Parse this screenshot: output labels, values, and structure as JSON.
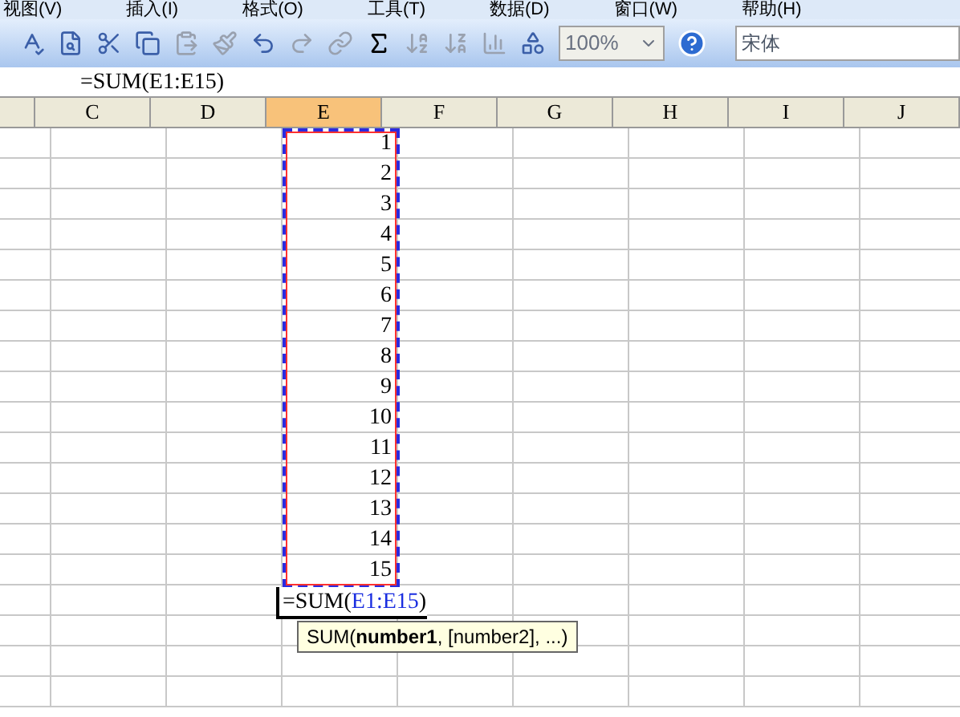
{
  "menu": [
    "视图(V)",
    "插入(I)",
    "格式(O)",
    "工具(T)",
    "数据(D)",
    "窗口(W)",
    "帮助(H)"
  ],
  "toolbar": {
    "zoom": "100%",
    "font": "宋体"
  },
  "formula_bar": {
    "value": "=SUM(E1:E15)"
  },
  "columns": [
    {
      "label": "C",
      "selected": false
    },
    {
      "label": "D",
      "selected": false
    },
    {
      "label": "E",
      "selected": true
    },
    {
      "label": "F",
      "selected": false
    },
    {
      "label": "G",
      "selected": false
    },
    {
      "label": "H",
      "selected": false
    },
    {
      "label": "I",
      "selected": false
    },
    {
      "label": "J",
      "selected": false
    }
  ],
  "cells": [
    "1",
    "2",
    "3",
    "4",
    "5",
    "6",
    "7",
    "8",
    "9",
    "10",
    "11",
    "12",
    "13",
    "14",
    "15"
  ],
  "editing_cell": {
    "prefix": "=SUM(",
    "ref": "E1:E15",
    "suffix": ")"
  },
  "tooltip": "SUM(**number1**, [number2], ...)"
}
